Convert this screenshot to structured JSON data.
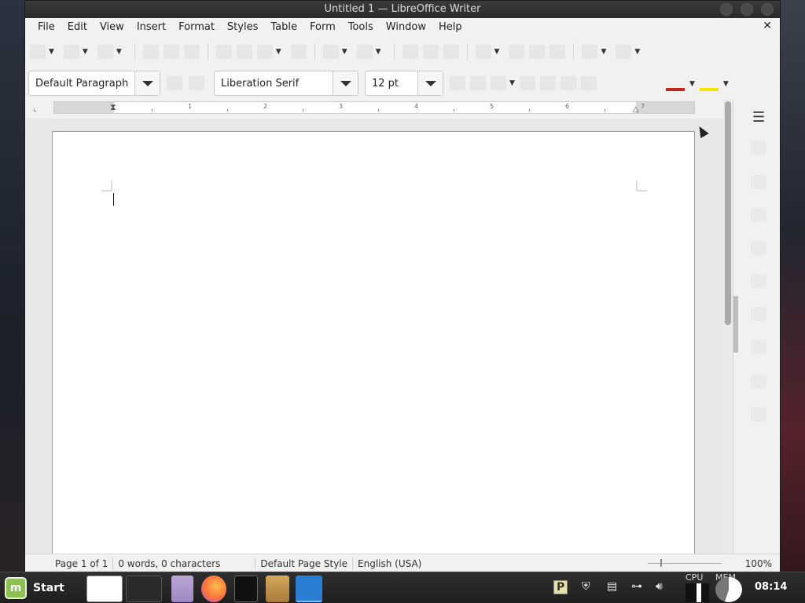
{
  "window": {
    "title": "Untitled 1 — LibreOffice Writer"
  },
  "menubar": {
    "items": [
      "File",
      "Edit",
      "View",
      "Insert",
      "Format",
      "Styles",
      "Table",
      "Form",
      "Tools",
      "Window",
      "Help"
    ],
    "close_glyph": "✕"
  },
  "formatting": {
    "paragraph_style": "Default Paragraph",
    "font_name": "Liberation Serif",
    "font_size": "12 pt",
    "font_color": "#c0281e",
    "highlight_color": "#f5e600"
  },
  "ruler": {
    "numbers": [
      "1",
      "2",
      "3",
      "4",
      "5",
      "6",
      "7"
    ]
  },
  "statusbar": {
    "page": "Page 1 of 1",
    "word_count": "0 words, 0 characters",
    "page_style": "Default Page Style",
    "language": "English (USA)",
    "zoom": "100%"
  },
  "taskbar": {
    "start_label": "Start",
    "cpu_label": "CPU",
    "mem_label": "MEM",
    "clock": "08:14"
  }
}
